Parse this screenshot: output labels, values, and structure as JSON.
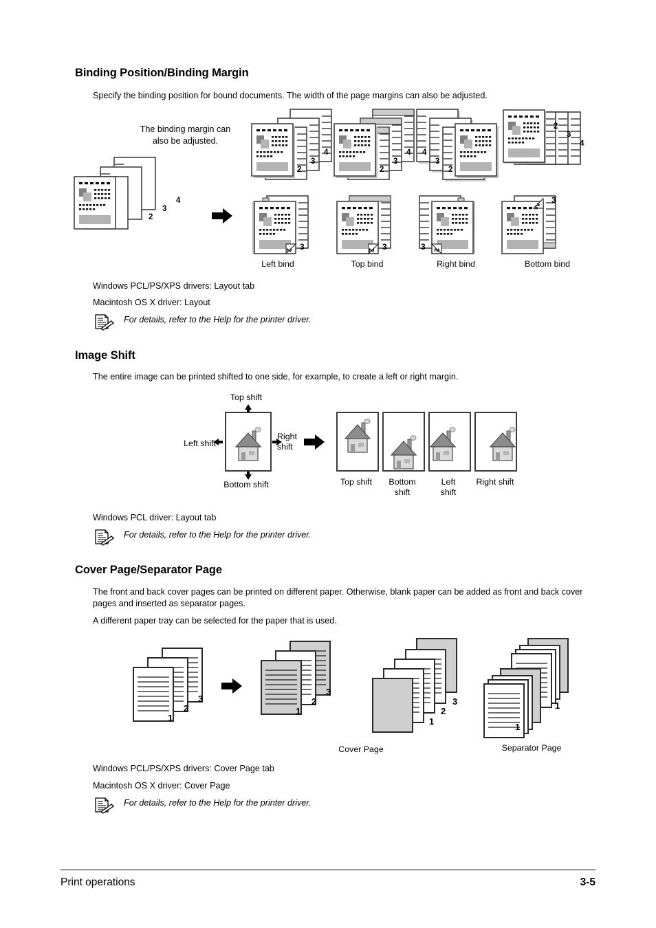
{
  "document": {
    "footer": {
      "left": "Print operations",
      "right": "3-5"
    }
  },
  "sections": [
    {
      "id": "binding",
      "heading": "Binding Position/Binding Margin",
      "intro": "Specify the binding position for bound documents. The width of the page margins can also be adjusted.",
      "diagram": {
        "margin_note_line1": "The binding margin can",
        "margin_note_line2": "also be adjusted.",
        "page_numbers": [
          "2",
          "3",
          "4"
        ],
        "captions": [
          "Left bind",
          "Top bind",
          "Right bind",
          "Bottom bind"
        ],
        "flap_number": "2",
        "back_number": "3"
      },
      "driver_lines": [
        "Windows PCL/PS/XPS drivers: Layout tab",
        "Macintosh OS X driver: Layout"
      ],
      "note": "For details, refer to the Help for the printer driver."
    },
    {
      "id": "image-shift",
      "heading": "Image Shift",
      "intro": "The entire image can be printed shifted to one side, for example, to create a left or right margin.",
      "diagram": {
        "top_label": "Top shift",
        "bottom_label": "Bottom shift",
        "left_label": "Left shift",
        "right_label_line1": "Right",
        "right_label_line2": "shift",
        "results": [
          {
            "line1": "Top shift",
            "line2": ""
          },
          {
            "line1": "Bottom",
            "line2": "shift"
          },
          {
            "line1": "Left",
            "line2": "shift"
          },
          {
            "line1": "Right shift",
            "line2": ""
          }
        ]
      },
      "driver_lines": [
        "Windows PCL driver: Layout tab"
      ],
      "note": "For details, refer to the Help for the printer driver."
    },
    {
      "id": "cover-page",
      "heading": "Cover Page/Separator Page",
      "intro": "The front and back cover pages can be printed on different paper. Otherwise, blank paper can be added as front and back cover pages and inserted as separator pages.",
      "intro2": "A different paper tray can be selected for the paper that is used.",
      "diagram": {
        "page_numbers": [
          "1",
          "2",
          "3"
        ],
        "captions": [
          "Cover Page",
          "Separator Page"
        ]
      },
      "driver_lines": [
        "Windows PCL/PS/XPS drivers: Cover Page tab",
        "Macintosh OS X driver: Cover Page"
      ],
      "note": "For details, refer to the Help for the printer driver."
    }
  ],
  "colors": {
    "text": "#000000",
    "paper_shadow": "#c9c9c9",
    "paper_gray": "#cfcfcf",
    "ink_gray": "#a8a8a8",
    "ink_dark": "#707070",
    "rule": "#000000"
  }
}
